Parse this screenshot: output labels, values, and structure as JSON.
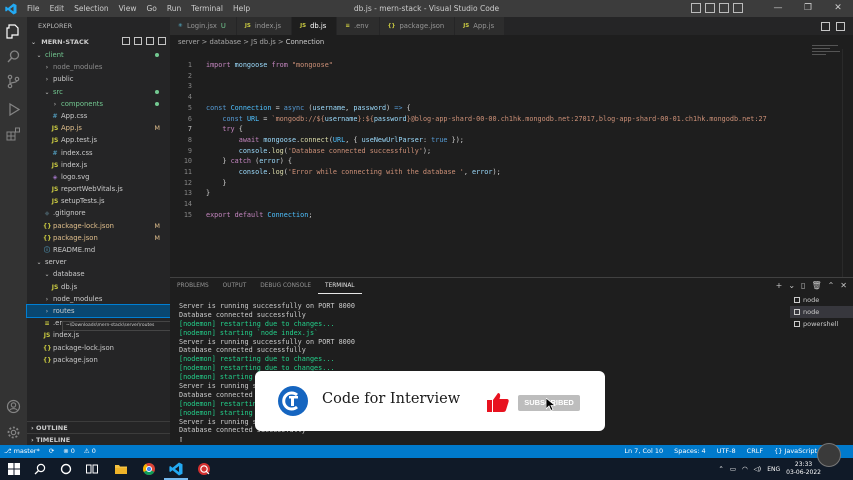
{
  "window": {
    "title": "db.js - mern-stack - Visual Studio Code",
    "menu": [
      "File",
      "Edit",
      "Selection",
      "View",
      "Go",
      "Run",
      "Terminal",
      "Help"
    ]
  },
  "sidebar": {
    "header": "EXPLORER",
    "project": "MERN-STACK",
    "tree": [
      {
        "label": "client",
        "kind": "folder-open",
        "indent": 0,
        "color": "green",
        "dot": true
      },
      {
        "label": "node_modules",
        "kind": "folder",
        "indent": 1,
        "color": "dim"
      },
      {
        "label": "public",
        "kind": "folder",
        "indent": 1,
        "color": "normal"
      },
      {
        "label": "src",
        "kind": "folder-open",
        "indent": 1,
        "color": "green",
        "dot": true
      },
      {
        "label": "components",
        "kind": "folder",
        "indent": 2,
        "color": "green",
        "dot": true
      },
      {
        "label": "App.css",
        "kind": "css",
        "indent": 2,
        "color": "normal"
      },
      {
        "label": "App.js",
        "kind": "js",
        "indent": 2,
        "color": "yellow",
        "badge": "M"
      },
      {
        "label": "App.test.js",
        "kind": "js",
        "indent": 2,
        "color": "normal"
      },
      {
        "label": "index.css",
        "kind": "css",
        "indent": 2,
        "color": "normal"
      },
      {
        "label": "index.js",
        "kind": "js",
        "indent": 2,
        "color": "normal"
      },
      {
        "label": "logo.svg",
        "kind": "svg",
        "indent": 2,
        "color": "normal"
      },
      {
        "label": "reportWebVitals.js",
        "kind": "js",
        "indent": 2,
        "color": "normal"
      },
      {
        "label": "setupTests.js",
        "kind": "js",
        "indent": 2,
        "color": "normal"
      },
      {
        "label": ".gitignore",
        "kind": "git",
        "indent": 1,
        "color": "normal"
      },
      {
        "label": "package-lock.json",
        "kind": "json",
        "indent": 1,
        "color": "yellow",
        "badge": "M"
      },
      {
        "label": "package.json",
        "kind": "json",
        "indent": 1,
        "color": "yellow",
        "badge": "M"
      },
      {
        "label": "README.md",
        "kind": "md",
        "indent": 1,
        "color": "normal"
      },
      {
        "label": "server",
        "kind": "folder-open",
        "indent": 0,
        "color": "normal"
      },
      {
        "label": "database",
        "kind": "folder-open",
        "indent": 1,
        "color": "normal"
      },
      {
        "label": "db.js",
        "kind": "js",
        "indent": 2,
        "color": "normal"
      },
      {
        "label": "node_modules",
        "kind": "folder",
        "indent": 1,
        "color": "normal"
      },
      {
        "label": "routes",
        "kind": "folder",
        "indent": 1,
        "color": "normal",
        "selected": true
      },
      {
        "label": ".env",
        "kind": "env",
        "indent": 1,
        "color": "normal"
      },
      {
        "label": "index.js",
        "kind": "js",
        "indent": 1,
        "color": "normal"
      },
      {
        "label": "package-lock.json",
        "kind": "json",
        "indent": 1,
        "color": "normal"
      },
      {
        "label": "package.json",
        "kind": "json",
        "indent": 1,
        "color": "normal"
      }
    ],
    "hover_tooltip": "~\\Downloads\\mern-stack\\server\\routes",
    "outline": "OUTLINE",
    "timeline": "TIMELINE"
  },
  "tabs": [
    {
      "label": "Login.jsx",
      "suffix": "U",
      "icon": "react",
      "active": false
    },
    {
      "label": "index.js",
      "icon": "js",
      "active": false
    },
    {
      "label": "db.js",
      "icon": "js",
      "active": true
    },
    {
      "label": ".env",
      "icon": "env",
      "active": false
    },
    {
      "label": "package.json",
      "icon": "json",
      "active": false
    },
    {
      "label": "App.js",
      "icon": "js",
      "active": false
    }
  ],
  "breadcrumb": {
    "path": "server > database > JS db.js > ",
    "symbol": "Connection"
  },
  "editor": {
    "current_line": 7,
    "lines": [
      {
        "n": 1,
        "tokens": [
          [
            "kw",
            "import "
          ],
          [
            "var",
            "mongoose "
          ],
          [
            "kw",
            "from "
          ],
          [
            "str",
            "\"mongoose\""
          ]
        ]
      },
      {
        "n": 2,
        "tokens": []
      },
      {
        "n": 3,
        "tokens": []
      },
      {
        "n": 4,
        "tokens": []
      },
      {
        "n": 5,
        "tokens": [
          [
            "kb",
            "const "
          ],
          [
            "cls",
            "Connection"
          ],
          [
            "code",
            " = "
          ],
          [
            "kb",
            "async "
          ],
          [
            "code",
            "("
          ],
          [
            "var",
            "username"
          ],
          [
            "code",
            ", "
          ],
          [
            "var",
            "password"
          ],
          [
            "code",
            ") "
          ],
          [
            "kb",
            "=> "
          ],
          [
            "code",
            "{"
          ]
        ]
      },
      {
        "n": 6,
        "tokens": [
          [
            "code",
            "    "
          ],
          [
            "kb",
            "const "
          ],
          [
            "cls",
            "URL"
          ],
          [
            "code",
            " = "
          ],
          [
            "str",
            "`mongodb://${"
          ],
          [
            "var",
            "username"
          ],
          [
            "str",
            "}:${"
          ],
          [
            "var",
            "password"
          ],
          [
            "str",
            "}@blog-app-shard-00-00.ch1hk.mongodb.net:27017,blog-app-shard-00-01.ch1hk.mongodb.net:27"
          ]
        ]
      },
      {
        "n": 7,
        "tokens": [
          [
            "code",
            "    "
          ],
          [
            "kw",
            "try "
          ],
          [
            "code",
            "{"
          ]
        ]
      },
      {
        "n": 8,
        "tokens": [
          [
            "code",
            "        "
          ],
          [
            "kw",
            "await "
          ],
          [
            "var",
            "mongoose"
          ],
          [
            "code",
            "."
          ],
          [
            "fn",
            "connect"
          ],
          [
            "code",
            "("
          ],
          [
            "cls",
            "URL"
          ],
          [
            "code",
            ", { "
          ],
          [
            "var",
            "useNewUrlParser"
          ],
          [
            "code",
            ": "
          ],
          [
            "kb",
            "true "
          ],
          [
            "code",
            "});"
          ]
        ]
      },
      {
        "n": 9,
        "tokens": [
          [
            "code",
            "        "
          ],
          [
            "var",
            "console"
          ],
          [
            "code",
            "."
          ],
          [
            "fn",
            "log"
          ],
          [
            "code",
            "("
          ],
          [
            "str",
            "'Database connected successfully'"
          ],
          [
            "code",
            ");"
          ]
        ]
      },
      {
        "n": 10,
        "tokens": [
          [
            "code",
            "    } "
          ],
          [
            "kw",
            "catch "
          ],
          [
            "code",
            "("
          ],
          [
            "var",
            "error"
          ],
          [
            "code",
            ") {"
          ]
        ]
      },
      {
        "n": 11,
        "tokens": [
          [
            "code",
            "        "
          ],
          [
            "var",
            "console"
          ],
          [
            "code",
            "."
          ],
          [
            "fn",
            "log"
          ],
          [
            "code",
            "("
          ],
          [
            "str",
            "'Error while connecting with the database '"
          ],
          [
            "code",
            ", "
          ],
          [
            "var",
            "error"
          ],
          [
            "code",
            ");"
          ]
        ]
      },
      {
        "n": 12,
        "tokens": [
          [
            "code",
            "    }"
          ]
        ]
      },
      {
        "n": 13,
        "tokens": [
          [
            "code",
            "}"
          ]
        ]
      },
      {
        "n": 14,
        "tokens": []
      },
      {
        "n": 15,
        "tokens": [
          [
            "kw",
            "export "
          ],
          [
            "kw",
            "default "
          ],
          [
            "cls",
            "Connection"
          ],
          [
            "code",
            ";"
          ]
        ]
      }
    ]
  },
  "panel": {
    "tabs": [
      "PROBLEMS",
      "OUTPUT",
      "DEBUG CONSOLE",
      "TERMINAL"
    ],
    "active_tab": "TERMINAL",
    "terminal_lines": [
      {
        "text": "Server is running successfully on PORT 8000",
        "green": false
      },
      {
        "text": "Database connected successfully",
        "green": false
      },
      {
        "text": "[nodemon] restarting due to changes...",
        "green": true
      },
      {
        "text": "[nodemon] starting `node index.js`",
        "green": true
      },
      {
        "text": "Server is running successfully on PORT 8000",
        "green": false
      },
      {
        "text": "Database connected successfully",
        "green": false
      },
      {
        "text": "[nodemon] restarting due to changes...",
        "green": true
      },
      {
        "text": "[nodemon] restarting due to changes...",
        "green": true
      },
      {
        "text": "[nodemon] starting `node index.js`",
        "green": true
      },
      {
        "text": "Server is running successfully on PORT 8000",
        "green": false
      },
      {
        "text": "Database connected successfully",
        "green": false
      },
      {
        "text": "[nodemon] restarting due to changes...",
        "green": true
      },
      {
        "text": "[nodemon] starting `node index.js`",
        "green": true
      },
      {
        "text": "Server is running successfully on PORT 8000",
        "green": false
      },
      {
        "text": "Database connected successfully",
        "green": false
      },
      {
        "text": "▯",
        "green": false
      }
    ],
    "terminals": [
      {
        "label": "node",
        "selected": false
      },
      {
        "label": "node",
        "selected": true
      },
      {
        "label": "powershell",
        "selected": false
      }
    ]
  },
  "banner": {
    "title": "Code for Interview",
    "button": "SUBSCRIBED"
  },
  "statusbar": {
    "branch": "master*",
    "sync": "⟳",
    "errors": "⊗ 0",
    "warnings": "⚠ 0",
    "position": "Ln 7, Col 10",
    "spaces": "Spaces: 4",
    "encoding": "UTF-8",
    "eol": "CRLF",
    "language": "{} JavaScript"
  },
  "taskbar": {
    "lang": "ENG",
    "time": "23:33",
    "date": "03-06-2022"
  },
  "colors": {
    "accent": "#007acc",
    "taskbar": "#101a28",
    "thumb": "#e8121f"
  }
}
